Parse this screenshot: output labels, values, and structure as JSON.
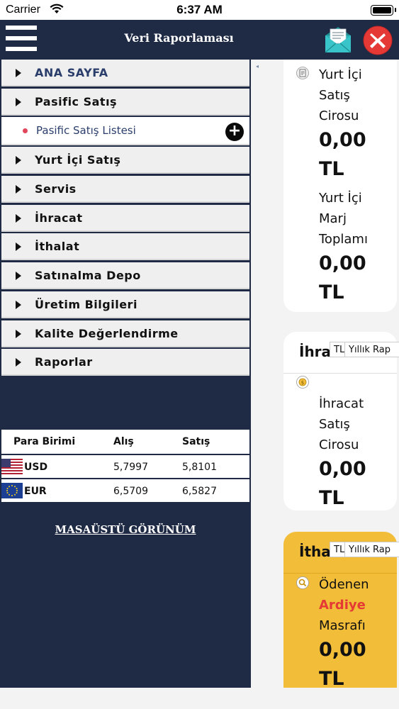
{
  "status": {
    "carrier": "Carrier",
    "time": "6:37 AM"
  },
  "header": {
    "title": "Veri Raporlaması"
  },
  "menu": {
    "home": "ANA SAYFA",
    "items": [
      "Pasific Satış",
      "Yurt İçi Satış",
      "Servis",
      "İhracat",
      "İthalat",
      "Satınalma Depo",
      "Üretim Bilgileri",
      "Kalite Değerlendirme",
      "Raporlar"
    ],
    "submenu": {
      "label": "Pasific Satış Listesi"
    }
  },
  "currency": {
    "headers": [
      "Para Birimi",
      "Alış",
      "Satış"
    ],
    "rows": [
      {
        "code": "USD",
        "buy": "5,7997",
        "sell": "5,8101"
      },
      {
        "code": "EUR",
        "buy": "6,5709",
        "sell": "6,5827"
      }
    ]
  },
  "desktop_link": "MASAÜSTÜ GÖRÜNÜM",
  "cards": {
    "domestic": {
      "metric1_lines": [
        "Yurt İçi",
        "Satış",
        "Cirosu"
      ],
      "metric1_value_lines": [
        "0,00",
        "TL"
      ],
      "metric2_lines": [
        "Yurt İçi",
        "Marj",
        "Toplamı"
      ],
      "metric2_value_lines": [
        "0,00",
        "TL"
      ]
    },
    "export": {
      "title": "İhra",
      "currency_tag": "TL",
      "period_tag": "Yıllık Rap",
      "metric_lines": [
        "İhracat",
        "Satış",
        "Cirosu"
      ],
      "value_lines": [
        "0,00",
        "TL"
      ]
    },
    "import": {
      "title": "İtha",
      "currency_tag": "TL",
      "period_tag": "Yıllık Rap",
      "metric_line1": "Ödenen",
      "metric_line2": "Ardiye",
      "metric_line3": "Masrafı",
      "value_lines": [
        "0,00",
        "TL"
      ]
    }
  },
  "colors": {
    "navy": "#1f2a44",
    "menu_bg": "#efefef",
    "import_card": "#f2bd38",
    "accent_red": "#e53935",
    "mail_teal": "#2bb3b7"
  }
}
